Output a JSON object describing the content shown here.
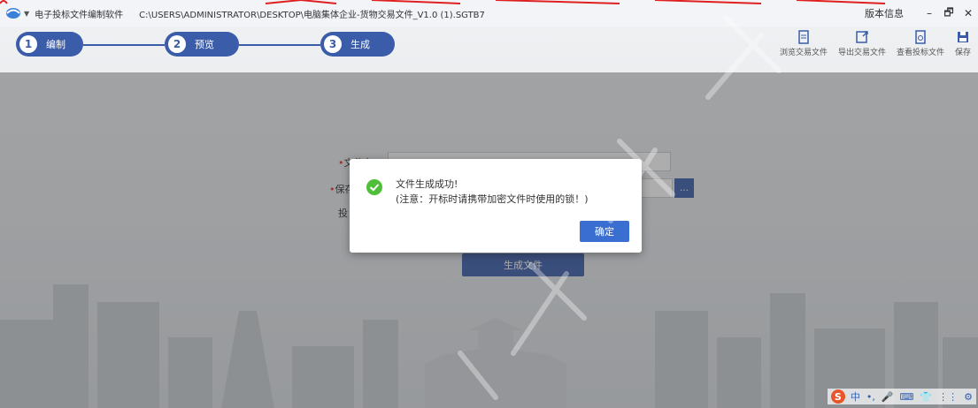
{
  "titlebar": {
    "app_name": "电子投标文件编制软件",
    "file_path": "C:\\USERS\\ADMINISTRATOR\\DESKTOP\\电脑集体企业-货物交易文件_V1.0 (1).SGTB7",
    "version_info": "版本信息",
    "minimize": "–",
    "restore": "🗗",
    "close": "✕"
  },
  "steps": [
    {
      "num": "1",
      "label": "编制"
    },
    {
      "num": "2",
      "label": "预览"
    },
    {
      "num": "3",
      "label": "生成"
    }
  ],
  "toolbar": [
    {
      "label": "浏览交易文件",
      "icon": "browse-doc-icon"
    },
    {
      "label": "导出交易文件",
      "icon": "export-doc-icon"
    },
    {
      "label": "查看投标文件",
      "icon": "view-bid-icon"
    },
    {
      "label": "保存",
      "icon": "save-icon"
    }
  ],
  "form": {
    "filename_label": "文件名",
    "savepath_label": "保存",
    "bidfile_label": "投",
    "browse_label": "…",
    "generate_button": "生成文件"
  },
  "dialog": {
    "message": "文件生成成功!",
    "note": "(注意：开标时请携带加密文件时使用的锁！)",
    "ok_button": "确定"
  },
  "ime": {
    "logo": "S",
    "items": [
      "中",
      "•,",
      "🎤",
      "⌨",
      "👕",
      "⋮⋮",
      "⚙"
    ]
  },
  "colors": {
    "accent": "#3a5ca9",
    "ok_button": "#3a6fd1",
    "success": "#4fbf3a"
  }
}
